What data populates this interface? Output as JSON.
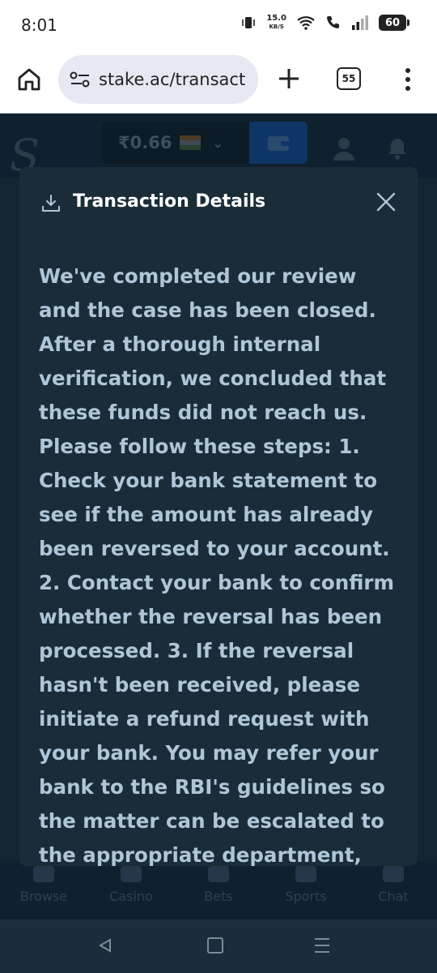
{
  "status_bar": {
    "time": "8:01",
    "speed_value": "15.0",
    "speed_unit": "KB/S",
    "battery": "60"
  },
  "browser": {
    "url": "stake.ac/transact",
    "tab_count": "55"
  },
  "site": {
    "balance": "₹0.66",
    "bottom_nav": [
      {
        "label": "Browse"
      },
      {
        "label": "Casino"
      },
      {
        "label": "Bets"
      },
      {
        "label": "Sports"
      },
      {
        "label": "Chat"
      }
    ]
  },
  "modal": {
    "title": "Transaction Details",
    "message": "We've completed our review and the case has been closed. After a thorough internal verification, we concluded that these funds did not reach us. Please follow these steps: 1. Check your bank statement to see if the amount has already been reversed to your account. 2. Contact your bank to confirm whether the reversal has been processed. 3. If the reversal hasn't been received, please initiate a refund request with your bank. You may refer your bank to the RBI's guidelines so the matter can be escalated to the appropriate department,"
  },
  "colors": {
    "modal_bg": "#1a2c38",
    "page_bg": "#0f212e",
    "body_text": "#aec6d6",
    "wallet_accent": "#0d3566"
  }
}
